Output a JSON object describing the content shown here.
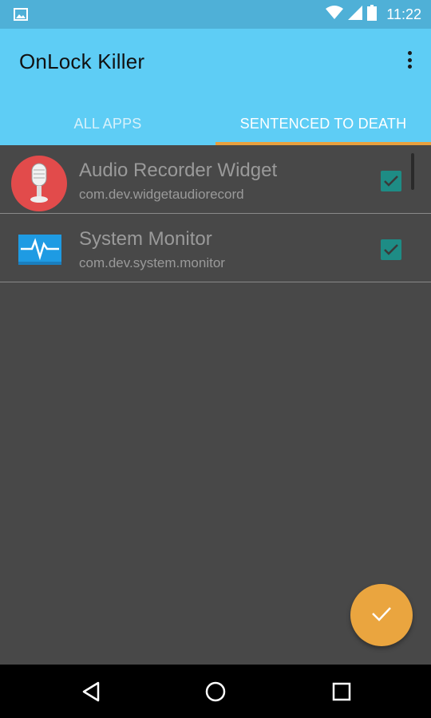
{
  "status_bar": {
    "time": "11:22",
    "icons": [
      "gallery-icon",
      "wifi-icon",
      "signal-icon",
      "battery-icon"
    ]
  },
  "app_bar": {
    "title": "OnLock Killer",
    "overflow_icon": "more-vert-icon"
  },
  "tabs": [
    {
      "label": "ALL APPS",
      "selected": false
    },
    {
      "label": "SENTENCED TO DEATH",
      "selected": true
    }
  ],
  "apps": [
    {
      "name": "Audio Recorder Widget",
      "package": "com.dev.widgetaudiorecord",
      "checked": true,
      "icon": "microphone-icon"
    },
    {
      "name": "System Monitor",
      "package": "com.dev.system.monitor",
      "checked": true,
      "icon": "monitor-icon"
    }
  ],
  "fab": {
    "icon": "check-icon"
  },
  "nav_bar": {
    "icons": [
      "back-icon",
      "home-icon",
      "recents-icon"
    ]
  },
  "colors": {
    "status_bar": "#4fb0d7",
    "app_bar": "#5ecdf5",
    "tab_indicator": "#e8a03e",
    "background": "#484848",
    "checkbox": "#1e8c85",
    "fab": "#eaa53f"
  }
}
